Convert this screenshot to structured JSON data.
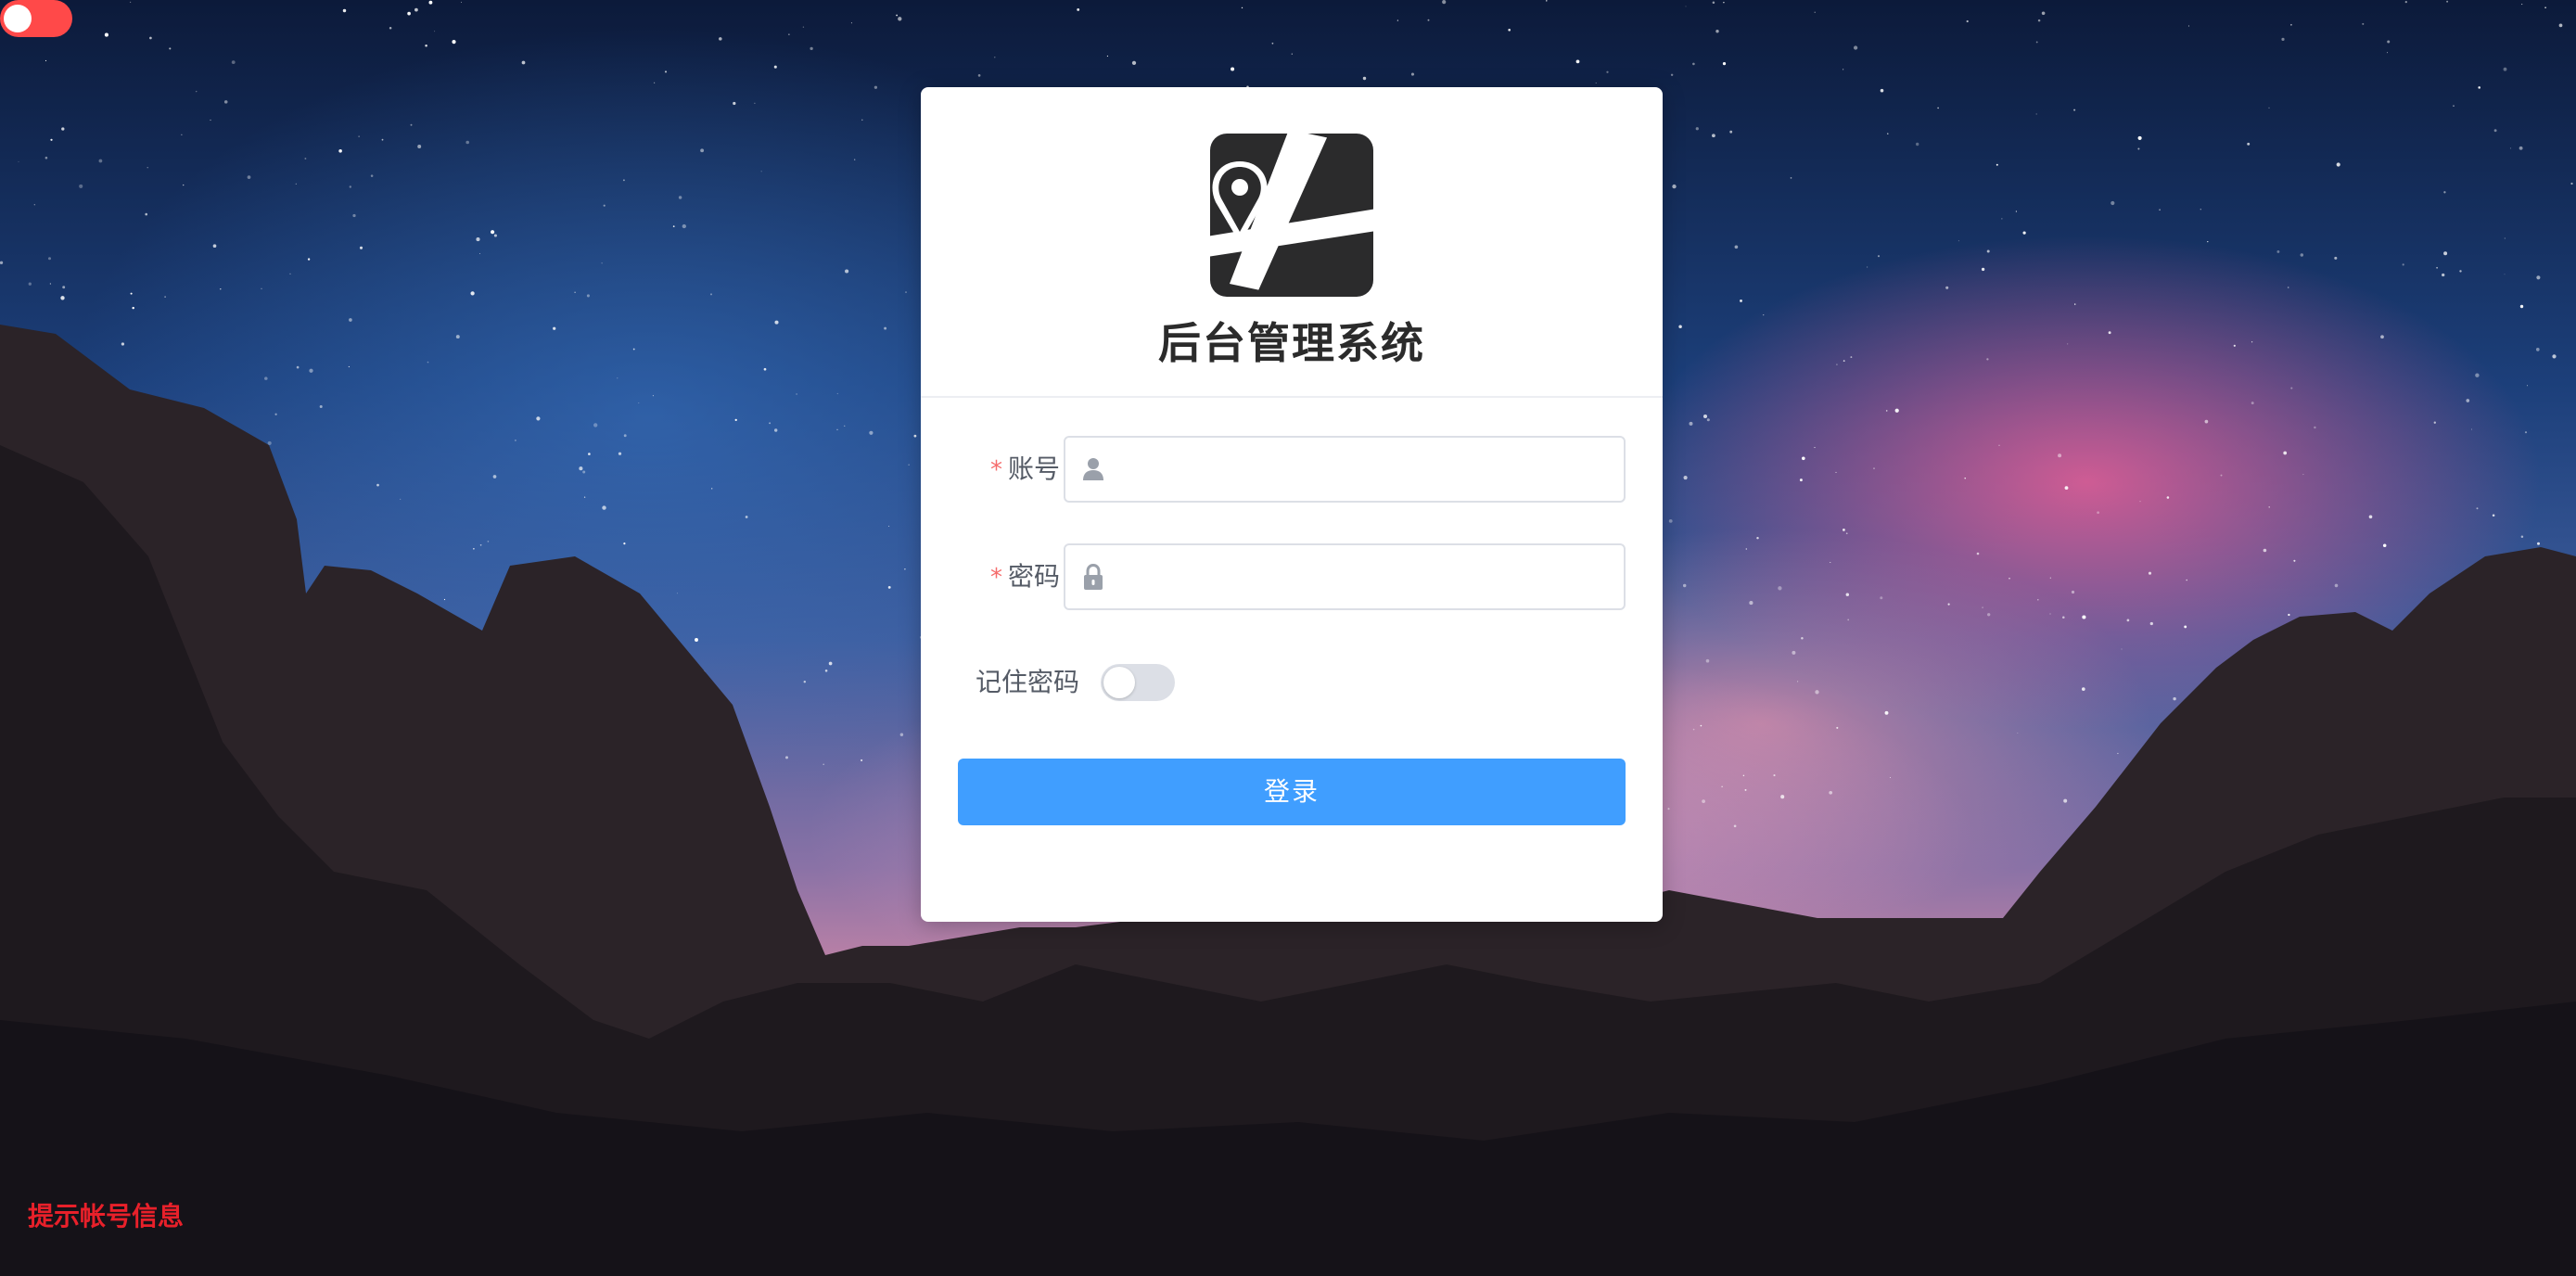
{
  "app": {
    "title": "后台管理系统"
  },
  "form": {
    "account_label": "账号",
    "password_label": "密码",
    "required_mark": "*",
    "account_value": "",
    "password_value": "",
    "remember_label": "记住密码",
    "remember_checked": false,
    "login_label": "登录"
  },
  "footer": {
    "hint_link": "提示帐号信息"
  },
  "top_toggle": {
    "on": false
  },
  "icons": {
    "logo": "map-pin-icon",
    "account": "user-icon",
    "password": "lock-icon"
  },
  "colors": {
    "primary": "#409eff",
    "danger": "#ff4949",
    "hint": "#e8202a",
    "required": "#f56c6c"
  }
}
